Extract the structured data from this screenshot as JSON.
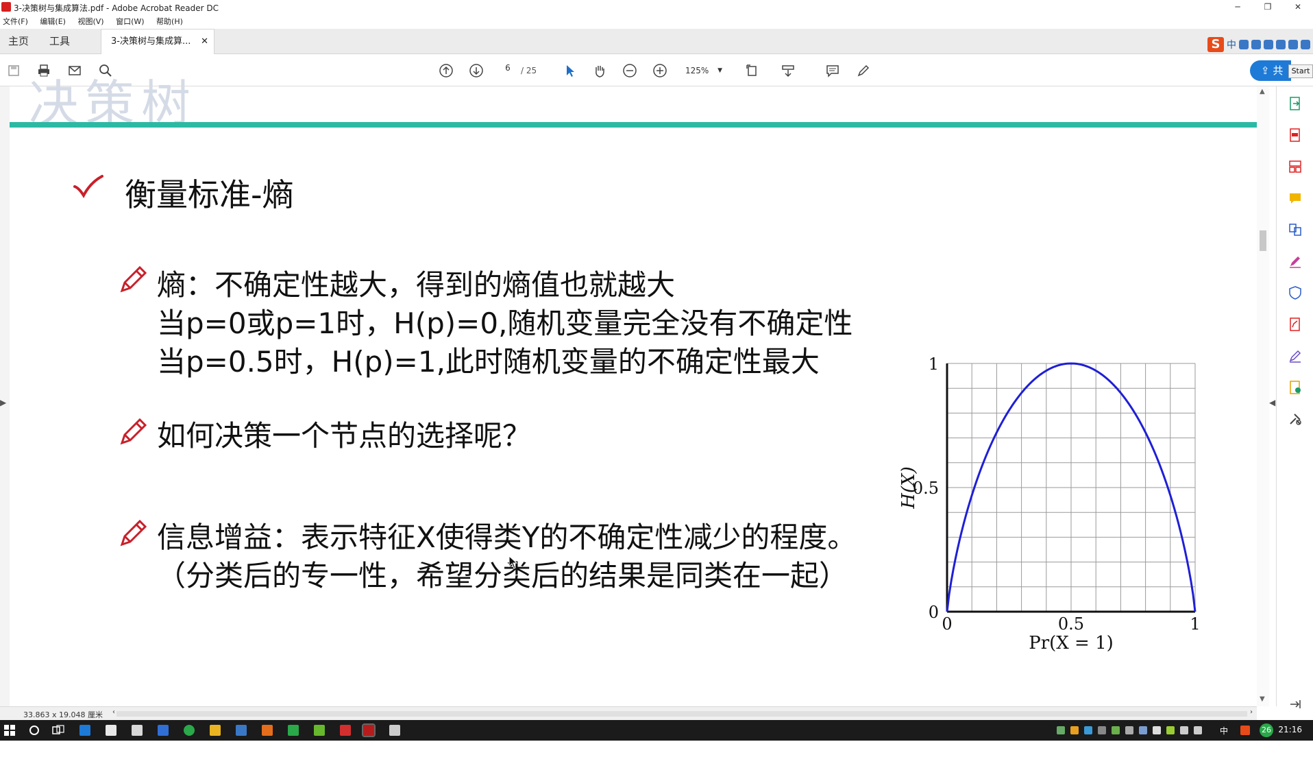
{
  "window": {
    "title": "3-决策树与集成算法.pdf - Adobe Acrobat Reader DC"
  },
  "menu": [
    "文件(F)",
    "编辑(E)",
    "视图(V)",
    "窗口(W)",
    "帮助(H)"
  ],
  "tabs": {
    "home": "主页",
    "tools": "工具",
    "document": "3-决策树与集成算..."
  },
  "toolbar": {
    "page_current": "6",
    "page_total": "/ 25",
    "zoom": "125%",
    "share_label": "共",
    "start_label": "Start"
  },
  "slide": {
    "heading_remnant": "决策树",
    "title": "衡量标准-熵",
    "bullets": [
      {
        "lines": [
          "熵：不确定性越大，得到的熵值也就越大",
          "当p=0或p=1时，H(p)=0,随机变量完全没有不确定性",
          "当p=0.5时，H(p)=1,此时随机变量的不确定性最大"
        ]
      },
      {
        "lines": [
          "如何决策一个节点的选择呢？"
        ]
      },
      {
        "lines": [
          "信息增益：表示特征X使得类Y的不确定性减少的程度。",
          "（分类后的专一性，希望分类后的结果是同类在一起）"
        ]
      }
    ]
  },
  "chart_data": {
    "type": "line",
    "xlabel": "Pr(X = 1)",
    "ylabel": "H(X)",
    "xlim": [
      0,
      1
    ],
    "ylim": [
      0,
      1
    ],
    "x_ticks": [
      "0",
      "0.5",
      "1"
    ],
    "y_ticks": [
      "0",
      "0.5",
      "1"
    ],
    "grid": true,
    "line_color": "#1f1fd6",
    "series": [
      {
        "x": [
          0,
          0.01,
          0.05,
          0.1,
          0.15,
          0.2,
          0.25,
          0.3,
          0.35,
          0.4,
          0.45,
          0.5,
          0.55,
          0.6,
          0.65,
          0.7,
          0.75,
          0.8,
          0.85,
          0.9,
          0.95,
          0.99,
          1
        ],
        "y": [
          0,
          0.081,
          0.286,
          0.469,
          0.61,
          0.722,
          0.811,
          0.881,
          0.934,
          0.971,
          0.993,
          1,
          0.993,
          0.971,
          0.934,
          0.881,
          0.811,
          0.722,
          0.61,
          0.469,
          0.286,
          0.081,
          0
        ]
      }
    ]
  },
  "status": {
    "dimensions": "33.863 x 19.048 厘米"
  },
  "taskbar": {
    "time": "21:16",
    "ime": "中",
    "badge": "26"
  },
  "colors": {
    "accent_teal": "#2bb9a4",
    "bullet_red": "#c8202a",
    "acrobat_blue": "#1e7ad7"
  }
}
